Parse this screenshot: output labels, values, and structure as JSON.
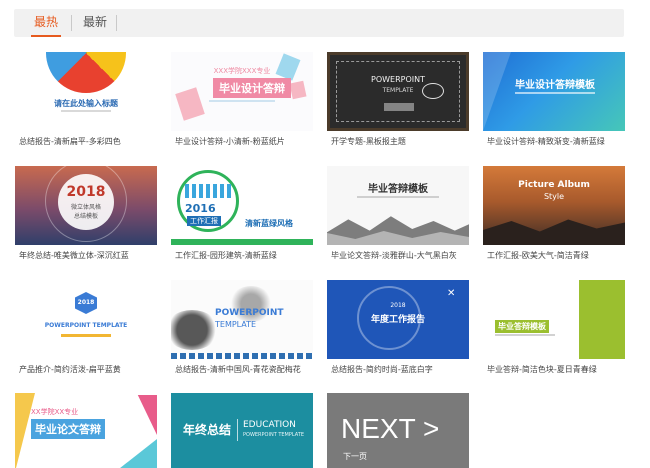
{
  "tabs": [
    {
      "label": "最热",
      "active": true
    },
    {
      "label": "最新",
      "active": false
    }
  ],
  "accent_color": "#e65a1e",
  "templates": [
    {
      "caption": "总结报告-清新扁平-多彩四色",
      "thumb_title": "请在此处输入标题",
      "theme": "colorful-flat"
    },
    {
      "caption": "毕业设计答辩-小清新-粉蓝纸片",
      "thumb_title": "毕业设计答辩",
      "thumb_kicker": "XXX学院XXX专业",
      "theme": "pink-blue-paper"
    },
    {
      "caption": "开学专题-黑板报主题",
      "thumb_title": "POWERPOINT",
      "thumb_sub": "TEMPLATE",
      "theme": "blackboard"
    },
    {
      "caption": "毕业设计答辩-精致渐变-清新蓝绿",
      "thumb_title": "毕业设计答辩模板",
      "theme": "blue-green-gradient"
    },
    {
      "caption": "年终总结-唯美微立体-深沉红蓝",
      "thumb_title": "2018",
      "thumb_sub": "微立体风格",
      "thumb_sub2": "总结模板",
      "theme": "red-blue-3d"
    },
    {
      "caption": "工作汇报-园形建筑-清新蓝绿",
      "thumb_title": "2016",
      "thumb_sub": "工作汇报",
      "thumb_side": "清新蓝绿风格",
      "theme": "round-building"
    },
    {
      "caption": "毕业论文答辩-淡雅群山-大气黑白灰",
      "thumb_title": "毕业答辩模板",
      "theme": "mountains-bw"
    },
    {
      "caption": "工作汇报-欧美大气-简洁青绿",
      "thumb_title": "Picture Album",
      "thumb_sub": "Style",
      "theme": "album-sunset"
    },
    {
      "caption": "产品推介-简约活泼-扁平蓝黄",
      "thumb_title": "2018",
      "thumb_sub": "POWERPOINT TEMPLATE",
      "theme": "flat-blue-yellow"
    },
    {
      "caption": "总结报告-清新中国风-青花瓷配梅花",
      "thumb_title": "POWERPOINT",
      "thumb_sub": "TEMPLATE",
      "theme": "porcelain"
    },
    {
      "caption": "总结报告-简约时尚-蓝底白字",
      "thumb_title": "年度工作报告",
      "thumb_kicker": "2018",
      "theme": "blue-white"
    },
    {
      "caption": "毕业答辩-简洁色块-夏日青春绿",
      "thumb_title": "毕业答辩模板",
      "theme": "summer-green"
    },
    {
      "caption": "",
      "thumb_title": "毕业论文答辩",
      "thumb_kicker": "XX学院XX专业",
      "theme": "thesis-pastel"
    },
    {
      "caption": "",
      "thumb_title": "年终总结",
      "thumb_sub": "EDUCATION",
      "thumb_sub2": "POWERPOINT TEMPLATE",
      "theme": "teal-education"
    },
    {
      "caption": "",
      "thumb_title": "NEXT >",
      "thumb_sub": "下一页",
      "theme": "next-page"
    }
  ]
}
